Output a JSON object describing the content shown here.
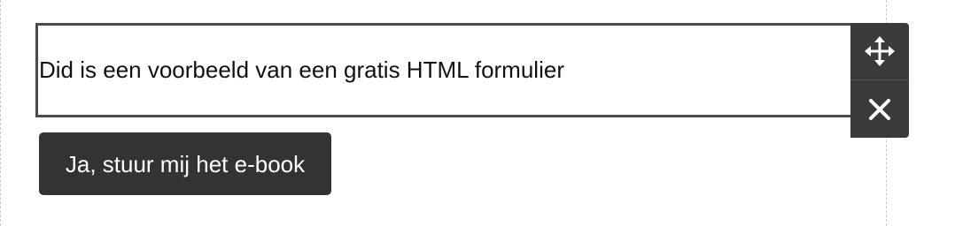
{
  "editor": {
    "text_block": {
      "text": "Did is een voorbeeld van een gratis HTML formulier"
    },
    "tools": {
      "move_icon": "move-arrows-icon",
      "close_icon": "close-icon"
    },
    "cta_button": {
      "label": "Ja, stuur mij het e-book"
    }
  },
  "colors": {
    "block_border": "#4a4a4a",
    "toolbar_bg": "#3a3a3a",
    "button_bg": "#333333",
    "button_text": "#ffffff",
    "guide_line": "#c9c9c9"
  }
}
